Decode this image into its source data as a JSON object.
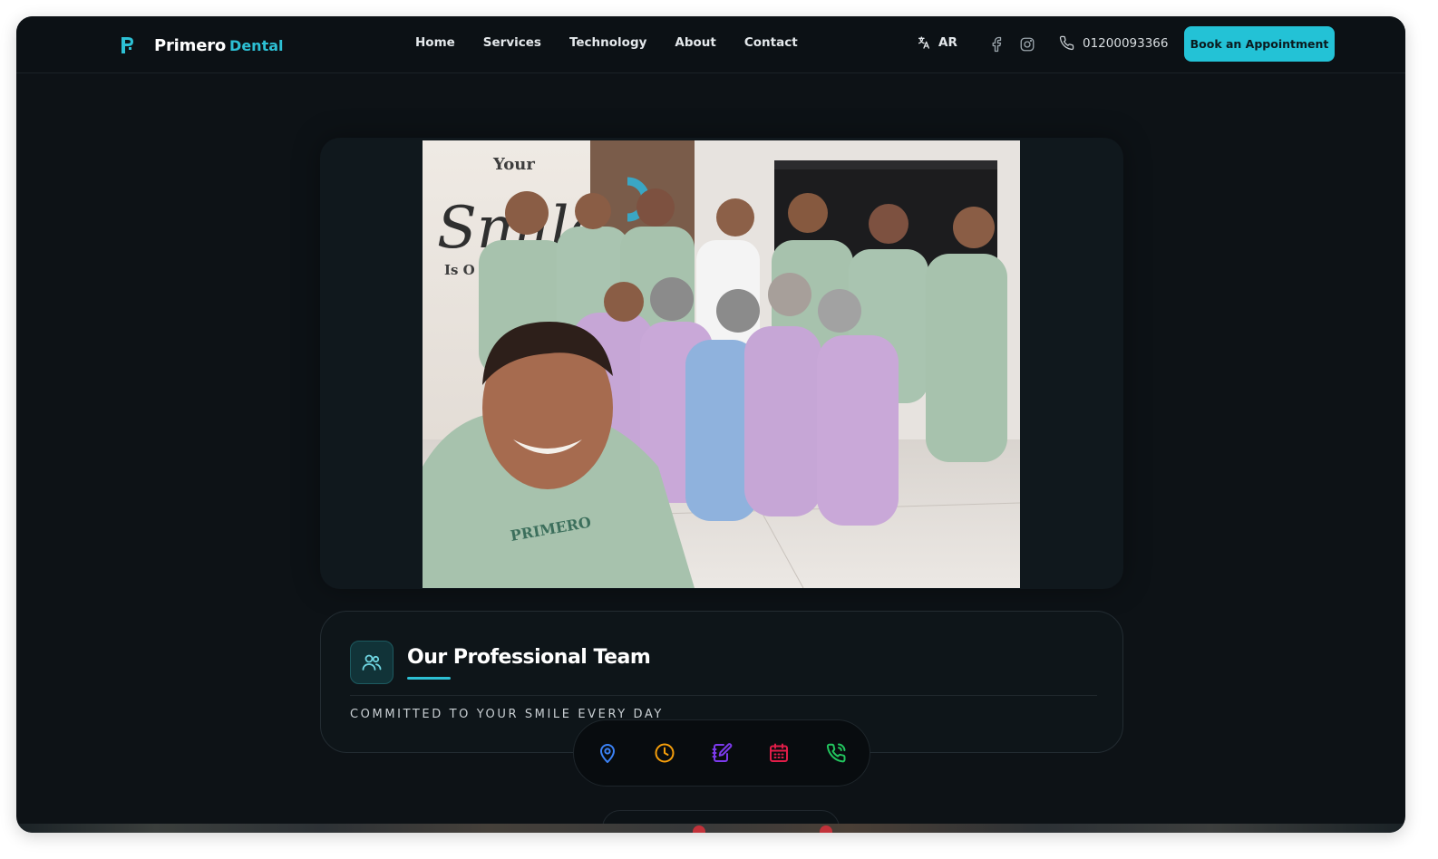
{
  "navbar": {
    "brand_name": "Primero",
    "brand_accent": "Dental",
    "links": [
      "Home",
      "Services",
      "Technology",
      "About",
      "Contact"
    ],
    "lang_label": "AR",
    "phone": "01200093366",
    "cta_label": "Book an Appointment",
    "icons": [
      "brand-logo-icon",
      "translate-icon",
      "facebook-icon",
      "instagram-icon",
      "phone-icon"
    ]
  },
  "hero": {
    "image": "team-photo",
    "photo_text": {
      "wall_your": "Your",
      "wall_smile": "Smile",
      "wall_is": "Is O",
      "shirt_logo": "PRIMERO"
    }
  },
  "team_section": {
    "icon": "users-icon",
    "title": "Our Professional Team",
    "subtitle": "COMMITTED TO YOUR SMILE EVERY DAY"
  },
  "dock": {
    "items": [
      {
        "icon": "location-pin-icon",
        "color": "#3b82f6"
      },
      {
        "icon": "clock-icon",
        "color": "#f59e0b"
      },
      {
        "icon": "edit-notes-icon",
        "color": "#7c3aed"
      },
      {
        "icon": "calendar-icon",
        "color": "#e11d48"
      },
      {
        "icon": "phone-call-icon",
        "color": "#22c55e"
      }
    ]
  },
  "colors": {
    "background": "#0d1216",
    "accent": "#23c2d6",
    "text": "#e8ecef"
  }
}
